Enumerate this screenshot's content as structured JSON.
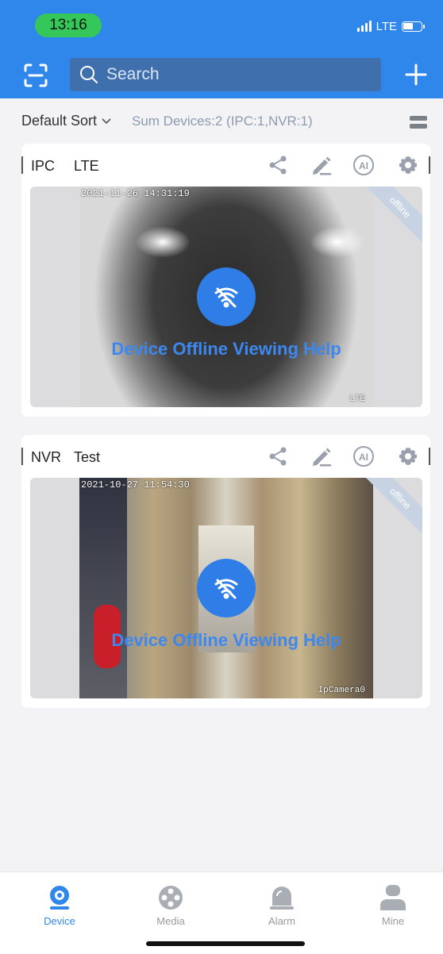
{
  "status_bar": {
    "time": "13:16",
    "network": "LTE"
  },
  "header": {
    "search_placeholder": "Search",
    "scan_icon": "scan-icon",
    "add_icon": "plus-icon"
  },
  "sort_bar": {
    "sort_label": "Default Sort",
    "summary": "Sum Devices:2 (IPC:1,NVR:1)"
  },
  "devices": [
    {
      "type": "IPC",
      "name": "LTE",
      "timestamp": "2021-11-26 14:31:19",
      "camera_label": "LTE",
      "badge": "offline",
      "help_text": "Device Offline Viewing Help"
    },
    {
      "type": "NVR",
      "name": "Test",
      "timestamp": "2021-10-27 11:54:30",
      "camera_label": "IpCamera0",
      "badge": "offline",
      "help_text": "Device Offline Viewing Help"
    }
  ],
  "tabs": [
    {
      "label": "Device",
      "icon": "camera-icon",
      "active": true
    },
    {
      "label": "Media",
      "icon": "film-reel-icon",
      "active": false
    },
    {
      "label": "Alarm",
      "icon": "alarm-bell-icon",
      "active": false
    },
    {
      "label": "Mine",
      "icon": "user-icon",
      "active": false
    }
  ],
  "colors": {
    "primary": "#2f87ec",
    "status_pill": "#35c759",
    "offline_badge": "#c7d3e3",
    "help_text": "#3d88f0"
  }
}
